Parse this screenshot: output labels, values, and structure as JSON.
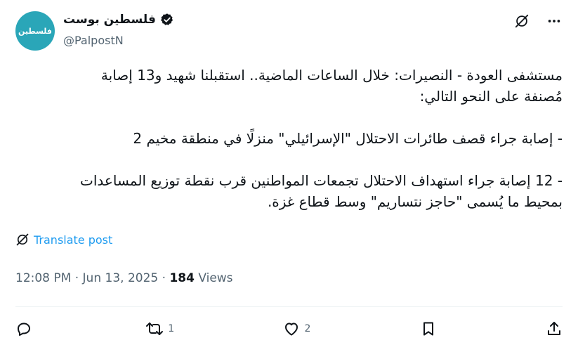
{
  "author": {
    "display_name": "فلسطين بوست",
    "handle": "@PalpostN",
    "avatar_text": "فلسطين",
    "avatar_color": "#2aa6b8"
  },
  "tweet": {
    "lines": [
      "مستشفى العودة - النصيرات: خلال الساعات الماضية.. استقبلنا شهيد و13 إصابة",
      "مُصنفة على النحو التالي:",
      "- إصابة جراء قصف طائرات الاحتلال \"الإسرائيلي\" منزلًا في منطقة مخيم 2",
      "- 12 إصابة جراء استهداف الاحتلال تجمعات المواطنين قرب نقطة توزيع المساعدات",
      "بمحيط ما يُسمى \"حاجز نتساريم\" وسط قطاع غزة."
    ],
    "translate_label": "Translate post",
    "time": "12:08 PM",
    "date": "Jun 13, 2025",
    "views_count": "184",
    "views_label": "Views"
  },
  "actions": {
    "reply_count": "",
    "retweet_count": "1",
    "like_count": "2"
  },
  "colors": {
    "link": "#1d9bf0",
    "muted": "#536471",
    "text": "#0f1419"
  }
}
